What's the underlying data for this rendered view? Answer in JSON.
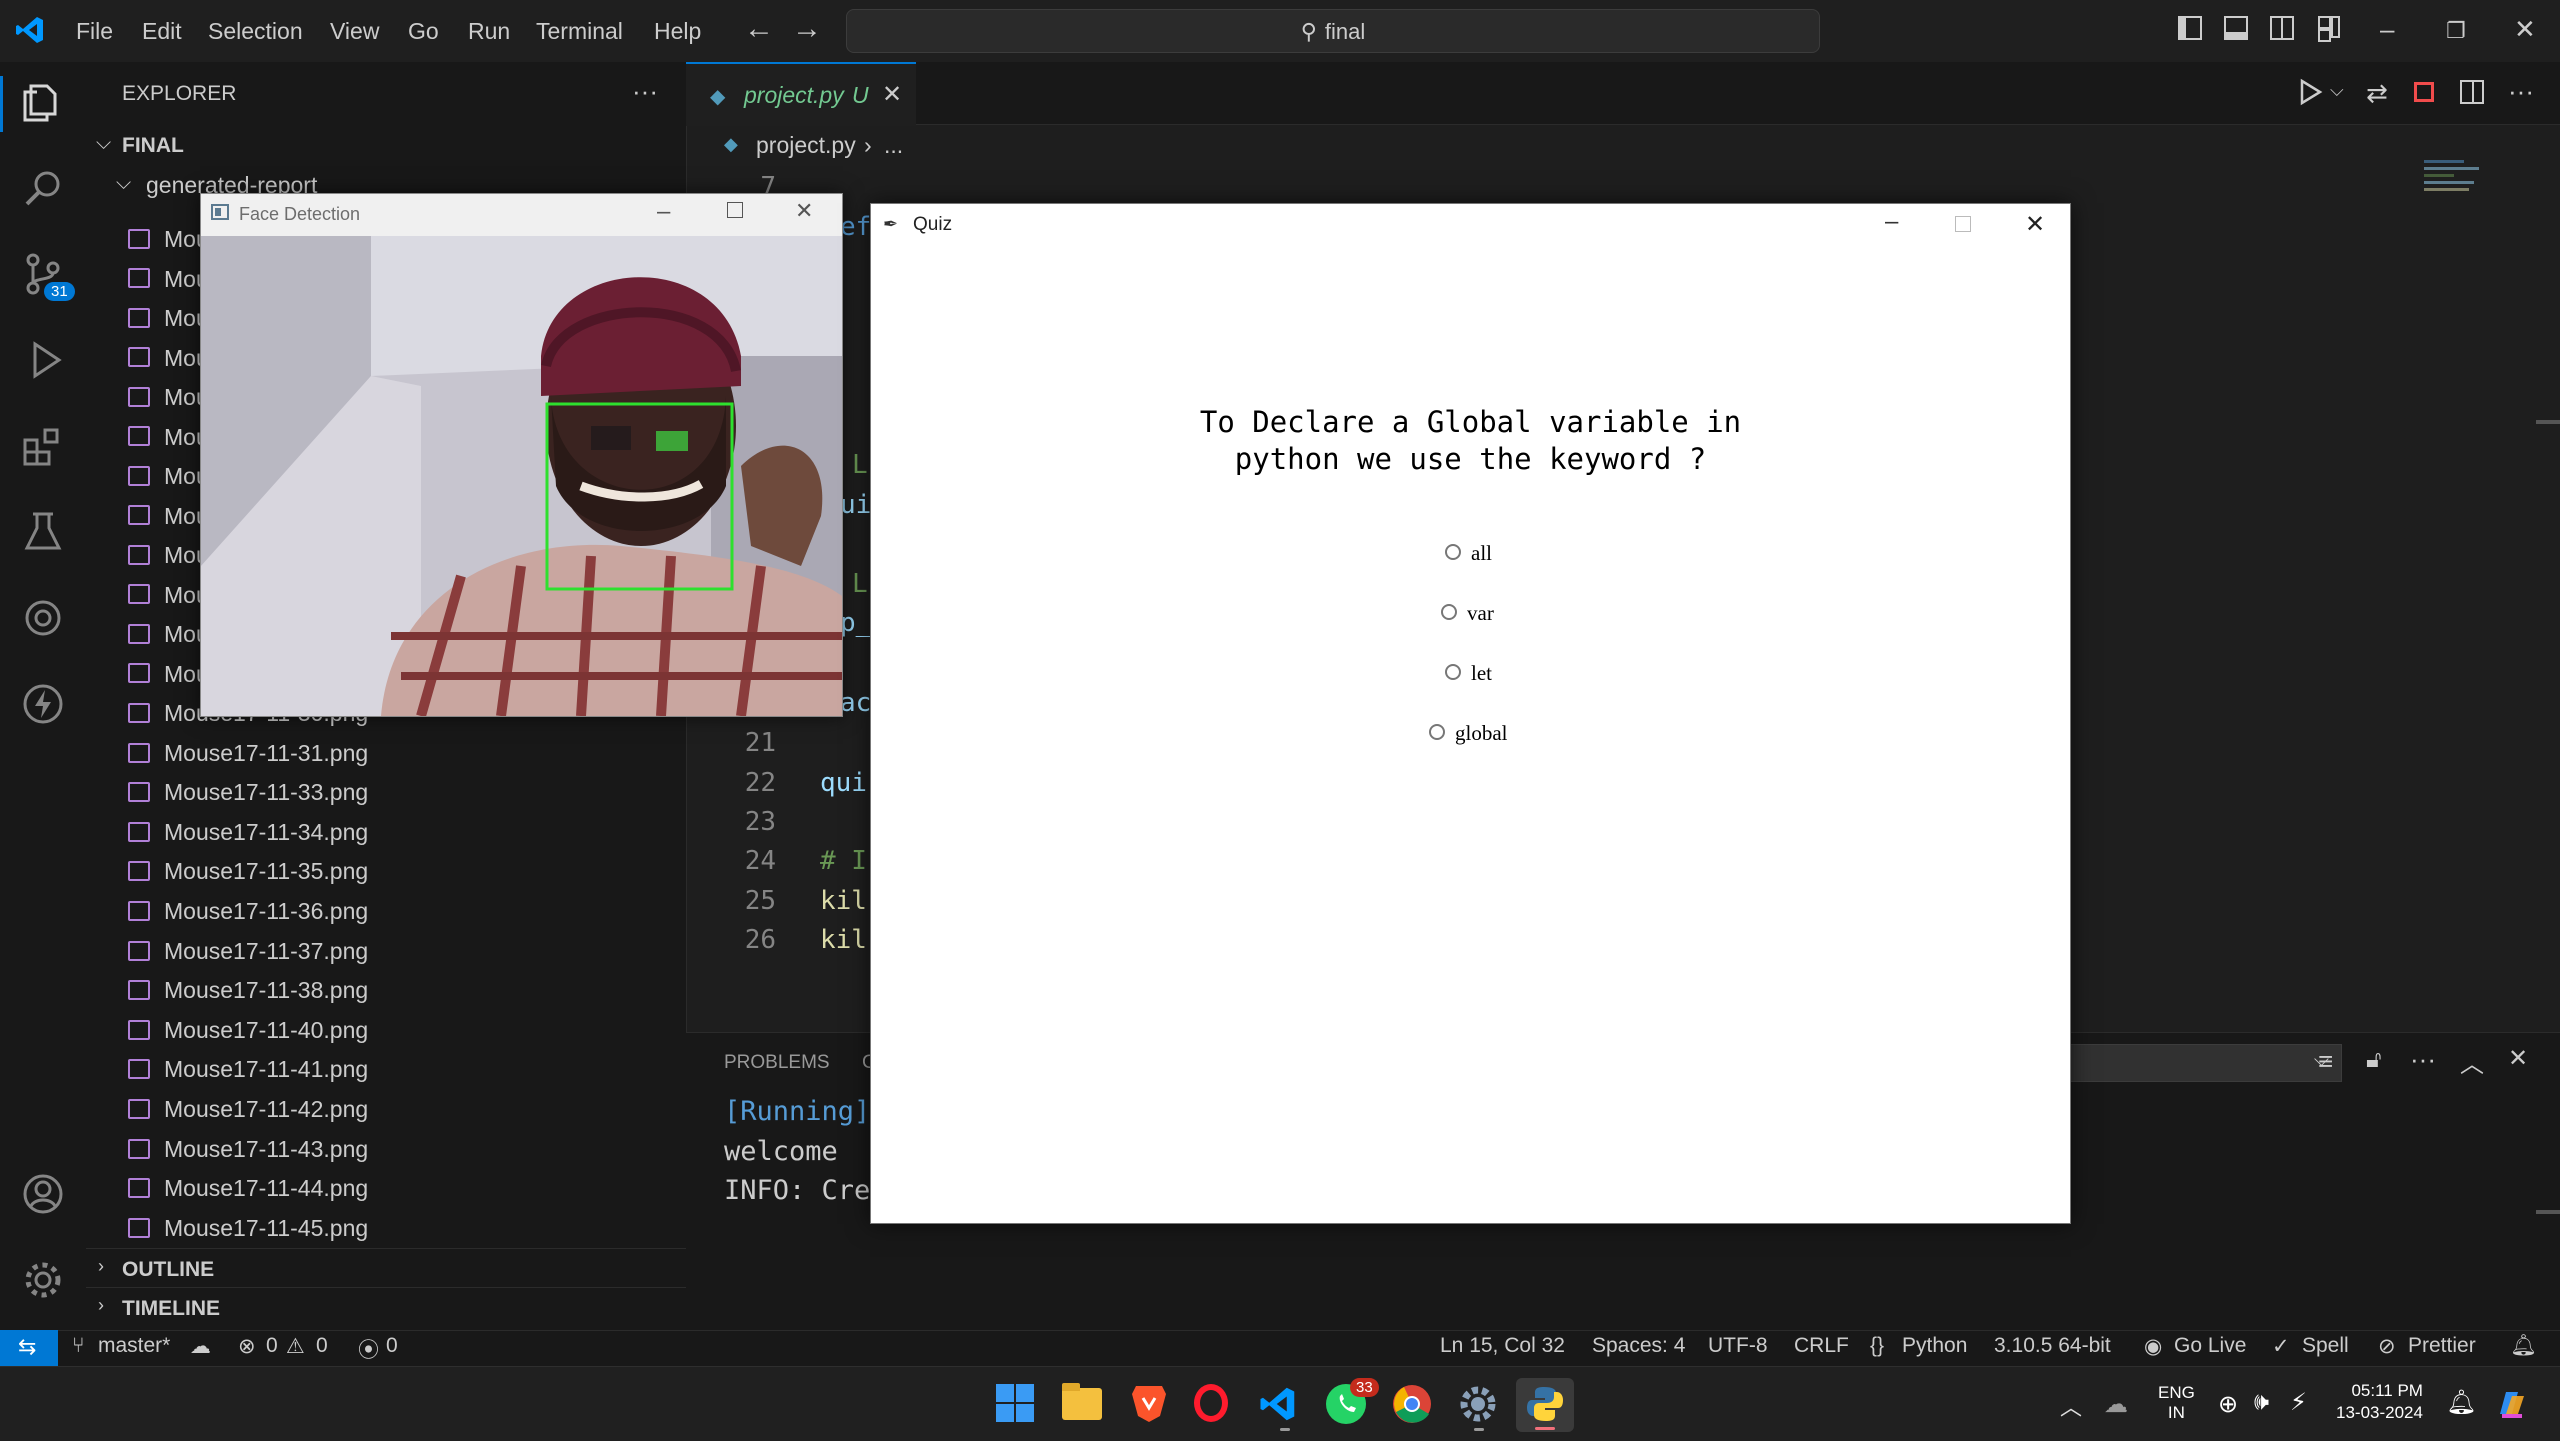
{
  "titlebar": {
    "menus": [
      "File",
      "Edit",
      "Selection",
      "View",
      "Go",
      "Run",
      "Terminal",
      "Help"
    ],
    "search_text": "final"
  },
  "activity": {
    "scm_badge": "31"
  },
  "sidebar": {
    "header": "EXPLORER",
    "more": "···",
    "root": "FINAL",
    "folder": "generated-report",
    "partial_files": [
      "Mou",
      "Mou",
      "Mou",
      "Mou",
      "Mou",
      "Mou",
      "Mou",
      "Mou",
      "Mou",
      "Mou",
      "Mou",
      "Mou"
    ],
    "files": [
      "Mouse17-11-30.png",
      "Mouse17-11-31.png",
      "Mouse17-11-33.png",
      "Mouse17-11-34.png",
      "Mouse17-11-35.png",
      "Mouse17-11-36.png",
      "Mouse17-11-37.png",
      "Mouse17-11-38.png",
      "Mouse17-11-40.png",
      "Mouse17-11-41.png",
      "Mouse17-11-42.png",
      "Mouse17-11-43.png",
      "Mouse17-11-44.png",
      "Mouse17-11-45.png"
    ],
    "outline": "OUTLINE",
    "timeline": "TIMELINE"
  },
  "editor": {
    "tab_name": "project.py",
    "tab_status": "U",
    "breadcrumb_file": "project.py",
    "breadcrumb_more": "...",
    "line_numbers": [
      "7",
      "21",
      "22",
      "23",
      "24",
      "25",
      "26"
    ],
    "code_fragments": [
      "ef",
      "L",
      "ui",
      "L",
      "p_",
      "ac",
      "qui",
      "# I",
      "kil",
      "kil"
    ]
  },
  "panel": {
    "tab_problems": "PROBLEMS",
    "tab_partial": "C",
    "terminal_lines": [
      "[Running]",
      "welcome",
      "INFO: Cre"
    ]
  },
  "statusbar": {
    "branch": "master*",
    "errors": "0",
    "warnings": "0",
    "ports": "0",
    "position": "Ln 15, Col 32",
    "spaces": "Spaces: 4",
    "encoding": "UTF-8",
    "eol": "CRLF",
    "language": "Python",
    "interpreter": "3.10.5 64-bit",
    "golive": "Go Live",
    "spell": "Spell",
    "prettier": "Prettier"
  },
  "face_window": {
    "title": "Face Detection"
  },
  "quiz": {
    "title": "Quiz",
    "question_line1": "To Declare a Global variable in",
    "question_line2": "python we use the keyword ?",
    "options": [
      "all",
      "var",
      "let",
      "global"
    ]
  },
  "taskbar": {
    "whatsapp_badge": "33",
    "lang_line1": "ENG",
    "lang_line2": "IN",
    "time": "05:11 PM",
    "date": "13-03-2024"
  },
  "colors": {
    "accent": "#0078d4",
    "status_remote": "#0078d4",
    "face_box": "#2ee02e"
  }
}
